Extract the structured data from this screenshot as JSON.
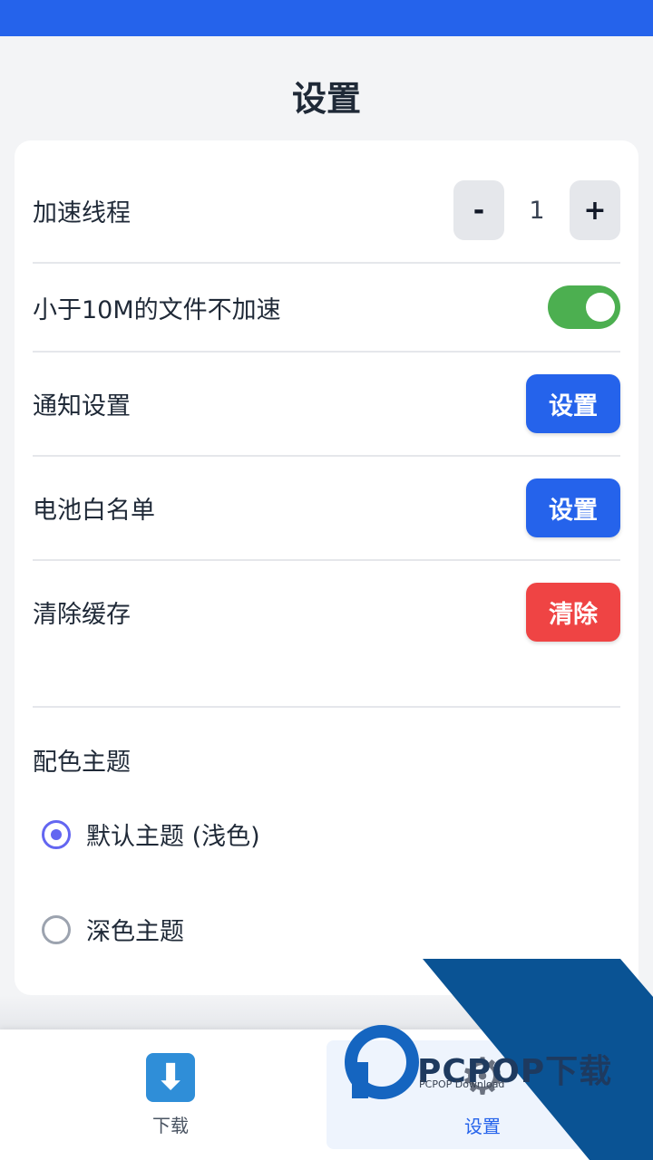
{
  "header": {
    "title": "设置"
  },
  "settings": {
    "threads": {
      "label": "加速线程",
      "minus": "-",
      "value": "1",
      "plus": "+"
    },
    "small_file": {
      "label": "小于10M的文件不加速",
      "enabled": true
    },
    "notify": {
      "label": "通知设置",
      "button": "设置"
    },
    "battery": {
      "label": "电池白名单",
      "button": "设置"
    },
    "cache": {
      "label": "清除缓存",
      "button": "清除"
    }
  },
  "theme": {
    "title": "配色主题",
    "options": [
      {
        "label": "默认主题 (浅色)",
        "selected": true
      },
      {
        "label": "深色主题",
        "selected": false
      }
    ]
  },
  "bottom_nav": {
    "items": [
      {
        "label": "下载",
        "icon": "download-icon",
        "active": false
      },
      {
        "label": "设置",
        "icon": "gear-icon",
        "active": true
      }
    ]
  },
  "watermark": {
    "text": "PCPOP下载",
    "sub": "PCPOP Download"
  },
  "colors": {
    "primary": "#2563eb",
    "danger": "#ef4444",
    "toggle_on": "#4caf50",
    "radio": "#6366f1"
  }
}
